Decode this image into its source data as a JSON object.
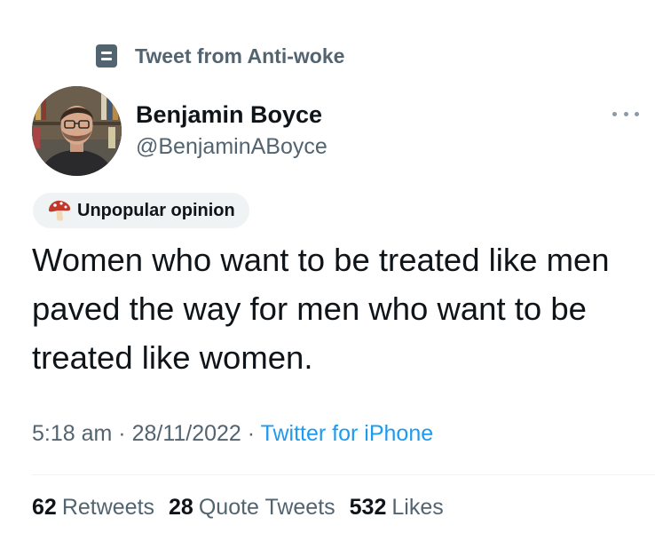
{
  "community": {
    "label": "Tweet from Anti-woke",
    "icon": "community-list-icon"
  },
  "author": {
    "name": "Benjamin Boyce",
    "handle": "@BenjaminABoyce",
    "avatar": "profile-photo"
  },
  "more_icon": "more-dots-icon",
  "topic": {
    "label": "Unpopular opinion",
    "icon": "mushroom-icon"
  },
  "tweet": {
    "text": "Women who want to be treated like men paved the way for men who want to be treated like women."
  },
  "meta": {
    "time": "5:18 am",
    "separator": " · ",
    "date": "28/11/2022",
    "source": "Twitter for iPhone"
  },
  "stats": {
    "retweets_count": "62",
    "retweets_label": "Retweets",
    "quotes_count": "28",
    "quotes_label": "Quote Tweets",
    "likes_count": "532",
    "likes_label": "Likes"
  },
  "colors": {
    "text_primary": "#0f1419",
    "text_secondary": "#536471",
    "link": "#1d9bf0",
    "pill_bg": "#eff3f4"
  }
}
